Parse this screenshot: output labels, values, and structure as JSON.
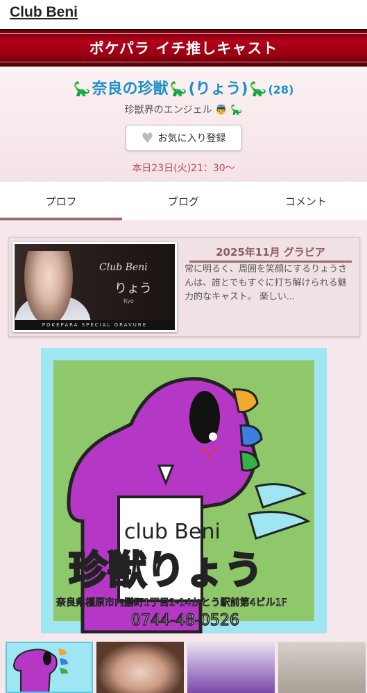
{
  "header": {
    "club_name": "Club Beni"
  },
  "banner": {
    "title": "ポケパラ イチ推しキャスト"
  },
  "cast": {
    "name": "奈良の珍獣",
    "nickname": "(りょう)",
    "age": "(28)",
    "catchphrase": "珍獣界のエンジェル",
    "favorite_label": "お気に入り登録",
    "schedule": "本日23日(火)21：30〜"
  },
  "tabs": [
    {
      "label": "プロフ",
      "active": true
    },
    {
      "label": "ブログ",
      "active": false
    },
    {
      "label": "コメント",
      "active": false
    }
  ],
  "gravure": {
    "title": "2025年11月 グラビア",
    "description": "常に明るく、周囲を笑顔にするりょうさんは、誰とでもすぐに打ち解けられる魅力的なキャスト。 楽しい...",
    "thumb_club": "Club Beni",
    "thumb_name": "りょう",
    "thumb_sub": "Ryo",
    "thumb_strip": "POKEPARA SPECIAL GRAVURE"
  },
  "main_image": {
    "text_club": "club Beni",
    "text_name": "珍獣りょう",
    "text_address": "奈良県橿原市内膳町1丁目2-14かとう駅前第4ビル1F",
    "text_phone": "0744-48-0526"
  },
  "colors": {
    "accent_red": "#b3001a",
    "name_blue": "#1d8fc9",
    "schedule_red": "#c2465a",
    "tab_underline": "#9a6b6f"
  }
}
